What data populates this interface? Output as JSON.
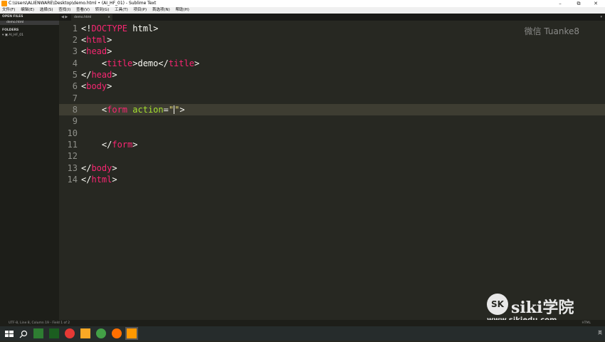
{
  "window": {
    "title": "C:\\Users\\ALIENWARE\\Desktop\\demo.html • (AI_HF_01) - Sublime Text"
  },
  "menu": [
    "文件(F)",
    "编辑(E)",
    "选择(S)",
    "查找(I)",
    "查看(V)",
    "转到(G)",
    "工具(T)",
    "项目(P)",
    "首选项(N)",
    "帮助(H)"
  ],
  "sidebar": {
    "open_files_header": "OPEN FILES",
    "open_file": "demo.html",
    "folders_header": "FOLDERS",
    "folder": "AI_HF_01"
  },
  "tabs": [
    {
      "label": "demo.html"
    }
  ],
  "editor": {
    "lines": [
      {
        "num": "1"
      },
      {
        "num": "2"
      },
      {
        "num": "3"
      },
      {
        "num": "4"
      },
      {
        "num": "5"
      },
      {
        "num": "6"
      },
      {
        "num": "7"
      },
      {
        "num": "8"
      },
      {
        "num": "9"
      },
      {
        "num": "10"
      },
      {
        "num": "11"
      },
      {
        "num": "12"
      },
      {
        "num": "13"
      },
      {
        "num": "14"
      }
    ],
    "code": {
      "l1a": "<!",
      "l1b": "DOCTYPE",
      "l1c": " html>",
      "l2a": "<",
      "l2b": "html",
      "l2c": ">",
      "l3a": "<",
      "l3b": "head",
      "l3c": ">",
      "l4a": "    <",
      "l4b": "title",
      "l4c": ">demo</",
      "l4d": "title",
      "l4e": ">",
      "l5a": "</",
      "l5b": "head",
      "l5c": ">",
      "l6a": "<",
      "l6b": "body",
      "l6c": ">",
      "l8a": "    <",
      "l8b": "form",
      "l8c": " ",
      "l8d": "action",
      "l8e": "=",
      "l8f": "\"",
      "l8g": "\"",
      "l8h": ">",
      "l11a": "    </",
      "l11b": "form",
      "l11c": ">",
      "l13a": "</",
      "l13b": "body",
      "l13c": ">",
      "l14a": "</",
      "l14b": "html",
      "l14c": ">"
    },
    "current_line": 8
  },
  "watermarks": {
    "wechat": "微信 Tuanke8",
    "brand": "siki学院",
    "brand_logo": "SK",
    "url": "www.sikiedu.com"
  },
  "status": {
    "left": "UTF-8, Line 8, Column 19 - Field 1 of 2",
    "right": "HTML"
  },
  "taskbar": {
    "tray": "英"
  }
}
